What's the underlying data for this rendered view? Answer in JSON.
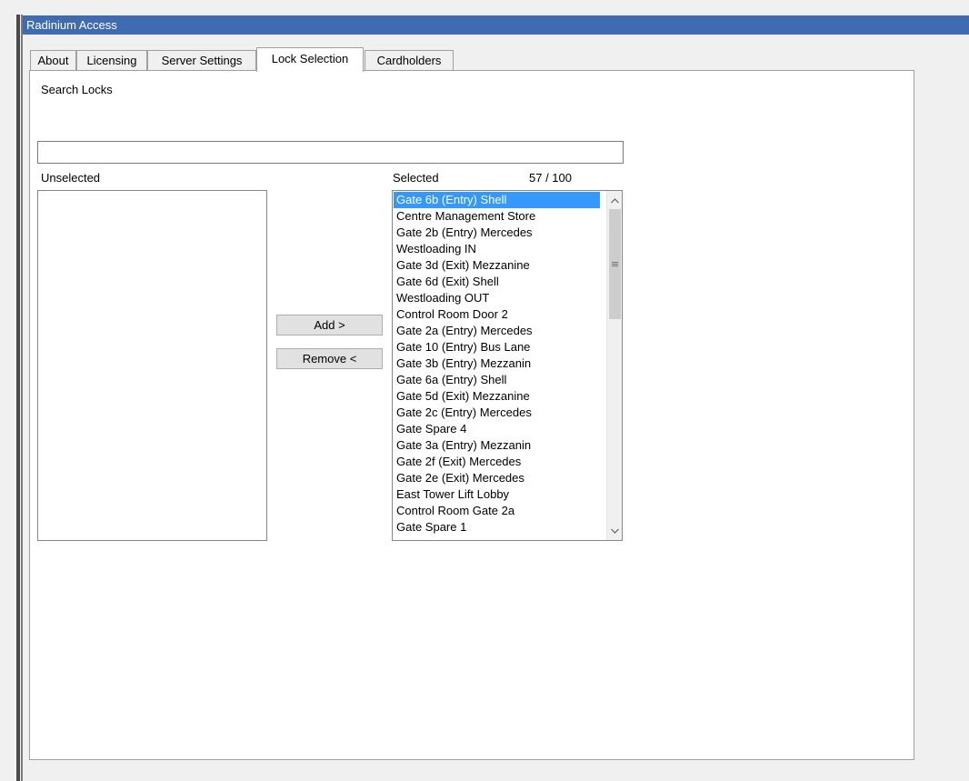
{
  "window": {
    "title": "Radinium Access"
  },
  "tabs": [
    {
      "label": "About"
    },
    {
      "label": "Licensing"
    },
    {
      "label": "Server Settings"
    },
    {
      "label": "Lock Selection"
    },
    {
      "label": "Cardholders"
    }
  ],
  "active_tab": "Lock Selection",
  "search": {
    "label": "Search Locks",
    "value": "",
    "placeholder": ""
  },
  "unselected": {
    "label": "Unselected",
    "items": []
  },
  "selected": {
    "label": "Selected",
    "count": "57 / 100",
    "selected_item": "Gate 6b (Entry) Shell",
    "items": [
      "Gate 6b (Entry) Shell",
      "Centre Management Store",
      "Gate 2b (Entry) Mercedes",
      "Westloading IN",
      "Gate 3d (Exit) Mezzanine",
      "Gate 6d (Exit) Shell",
      "Westloading OUT",
      "Control Room Door 2",
      "Gate 2a (Entry) Mercedes",
      "Gate 10 (Entry) Bus Lane",
      "Gate 3b (Entry) Mezzanin",
      "Gate 6a (Entry) Shell",
      "Gate 5d (Exit) Mezzanine",
      "Gate 2c (Entry) Mercedes",
      "Gate Spare 4",
      "Gate 3a (Entry) Mezzanin",
      "Gate 2f (Exit) Mercedes",
      "Gate 2e (Exit) Mercedes",
      "East Tower Lift Lobby",
      "Control Room Gate 2a",
      "Gate Spare 1"
    ]
  },
  "buttons": {
    "add": "Add >",
    "remove": "Remove <"
  },
  "colors": {
    "titlebar": "#3f6cb0",
    "selection": "#3399ff"
  }
}
